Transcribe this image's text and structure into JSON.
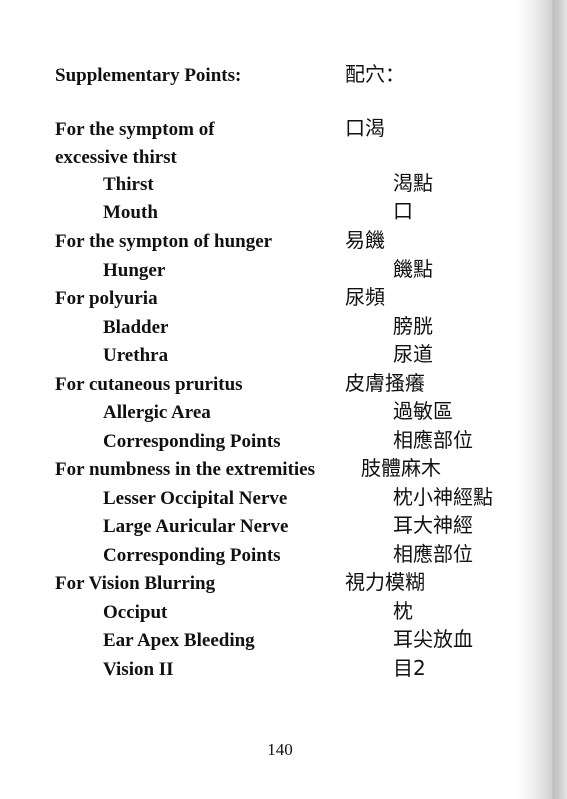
{
  "header": {
    "label": "Supplementary Points:",
    "chinese": "配穴："
  },
  "entries": [
    {
      "en": "For the symptom of",
      "zh": "口渴"
    },
    {
      "en": "excessive thirst",
      "zh": ""
    },
    {
      "en": "Thirst",
      "zh": "渴點"
    },
    {
      "en": "Mouth",
      "zh": "口"
    },
    {
      "en": "For the sympton of hunger",
      "zh": "易饑"
    },
    {
      "en": "Hunger",
      "zh": "饑點"
    },
    {
      "en": "For polyuria",
      "zh": "尿頻"
    },
    {
      "en": "Bladder",
      "zh": "膀胱"
    },
    {
      "en": "Urethra",
      "zh": "尿道"
    },
    {
      "en": "For cutaneous pruritus",
      "zh": "皮膚搔癢"
    },
    {
      "en": "Allergic Area",
      "zh": "過敏區"
    },
    {
      "en": "Corresponding Points",
      "zh": "相應部位"
    },
    {
      "en": "For numbness in the extremities",
      "zh": "肢體麻木"
    },
    {
      "en": "Lesser Occipital Nerve",
      "zh": "枕小神經點"
    },
    {
      "en": "Large Auricular Nerve",
      "zh": "耳大神經"
    },
    {
      "en": "Corresponding Points",
      "zh": "相應部位"
    },
    {
      "en": "For Vision Blurring",
      "zh": "視力模糊"
    },
    {
      "en": "Occiput",
      "zh": "枕"
    },
    {
      "en": "Ear Apex Bleeding",
      "zh": "耳尖放血"
    },
    {
      "en": "Vision II",
      "zh": "目2"
    }
  ],
  "page_number": "140"
}
